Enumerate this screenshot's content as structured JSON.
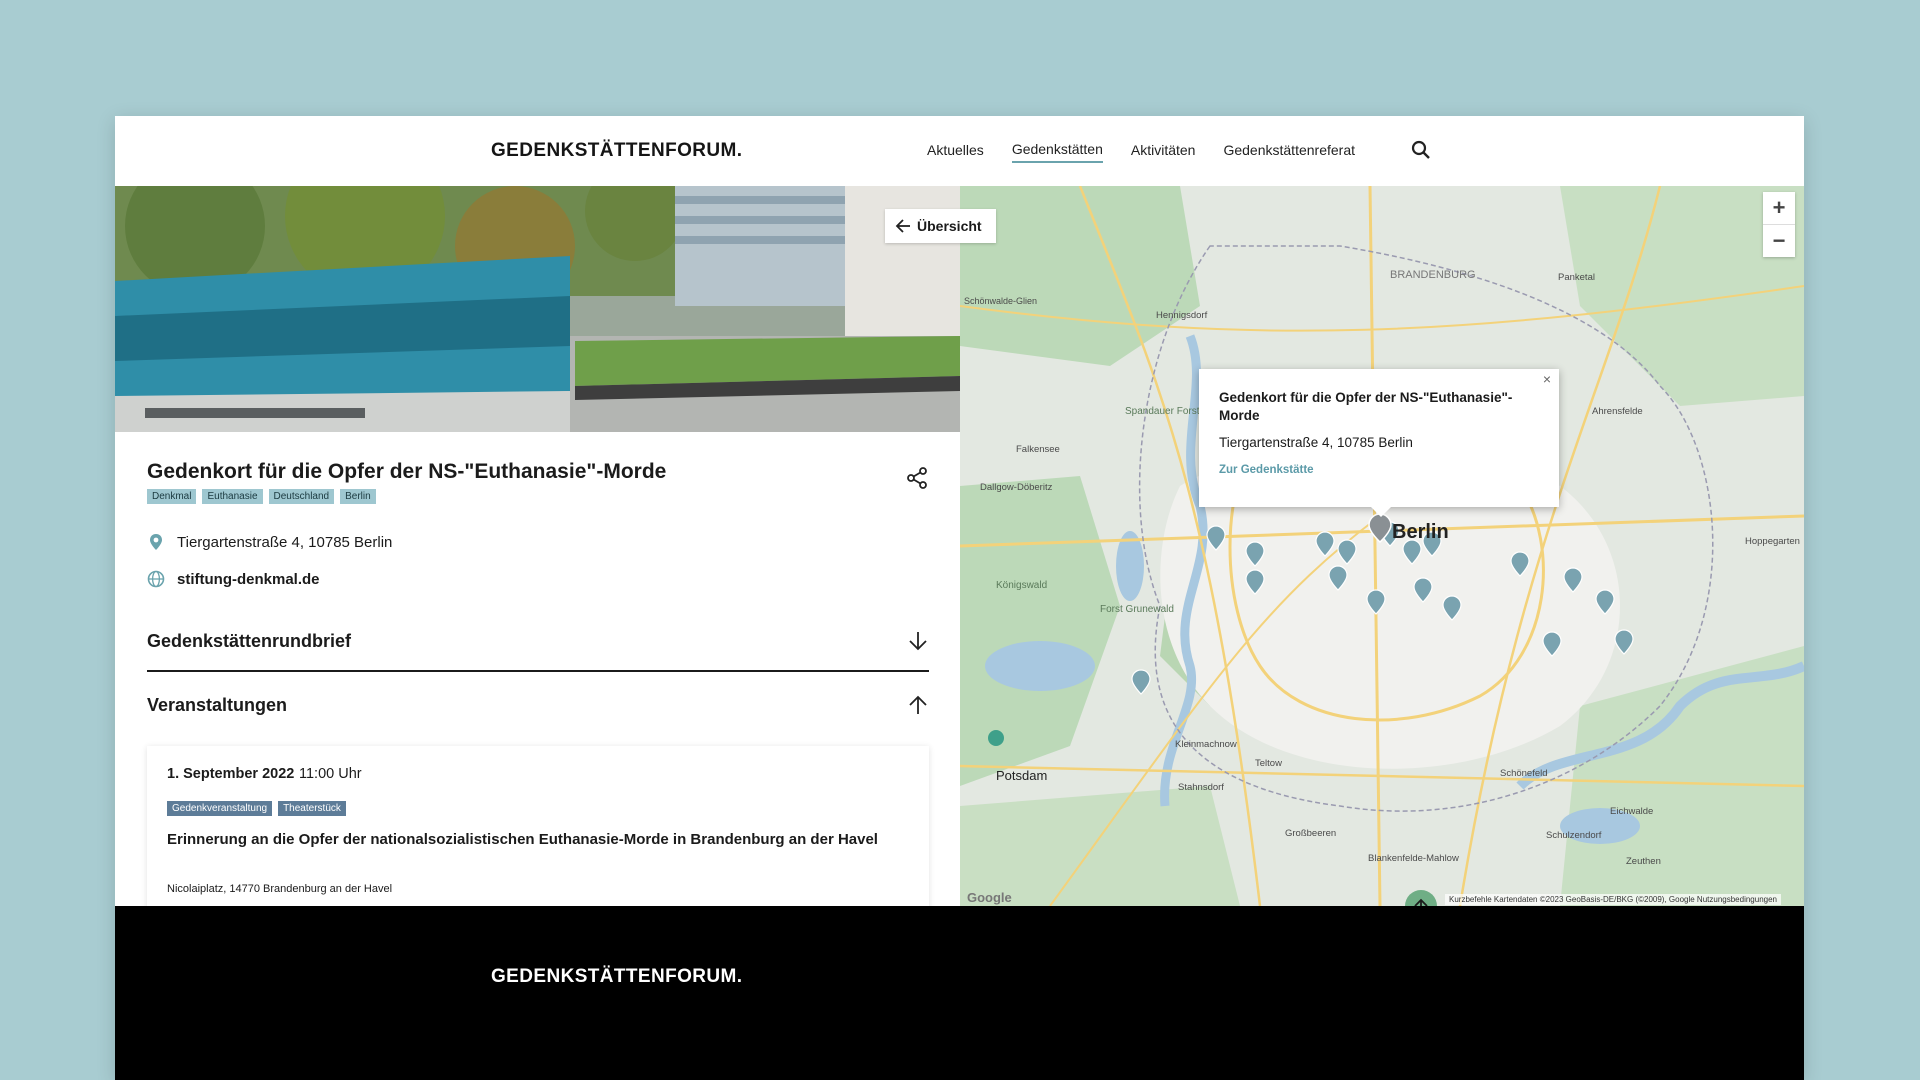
{
  "header": {
    "logo": "GEDENKSTÄTTENFORUM.",
    "nav": [
      {
        "label": "Aktuelles"
      },
      {
        "label": "Gedenkstätten"
      },
      {
        "label": "Aktivitäten"
      },
      {
        "label": "Gedenkstättenreferat"
      }
    ]
  },
  "site": {
    "title": "Gedenkort für die Opfer der NS-\"Euthanasie\"-Morde",
    "tags": [
      "Denkmal",
      "Euthanasie",
      "Deutschland",
      "Berlin"
    ],
    "address": "Tiergartenstraße 4, 10785 Berlin",
    "website": "stiftung-denkmal.de"
  },
  "accordion": {
    "newsletter": "Gedenkstättenrundbrief",
    "events": "Veranstaltungen"
  },
  "event": {
    "date": "1. September 2022",
    "time": "11:00 Uhr",
    "tags": [
      "Gedenkveranstaltung",
      "Theaterstück"
    ],
    "title": "Erinnerung an die Opfer der nationalsozialistischen Euthanasie-Morde in Brandenburg an der Havel",
    "location": "Nicolaiplatz, 14770 Brandenburg an der Havel"
  },
  "map": {
    "overview_label": "Übersicht",
    "popup_title": "Gedenkort für die Opfer der NS-\"Euthanasie\"-Morde",
    "popup_address": "Tiergartenstraße 4, 10785 Berlin",
    "popup_link": "Zur Gedenkstätte",
    "labels": [
      "Berlin",
      "Potsdam",
      "Falkensee",
      "Teltow",
      "Stahnsdorf",
      "Kleinmachnow",
      "Schulzendorf",
      "Zeuthen",
      "Hoppegarten",
      "Spandauer Forst",
      "Forst Grunewald",
      "Königswald",
      "Schönwalde-Glien",
      "Hennigsdorf",
      "Dallgow-Döberitz",
      "Panketal",
      "Ahrensfelde",
      "Eichwalde",
      "Schönefeld",
      "Großbeeren",
      "Blankenfelde-Mahlow",
      "BRANDENBURG"
    ],
    "attribution": "Kurzbefehle   Kartendaten ©2023 GeoBasis-DE/BKG (©2009), Google   Nutzungsbedingungen",
    "google": "Google",
    "zoom_in": "+",
    "zoom_out": "−",
    "close": "×"
  },
  "footer": {
    "logo": "GEDENKSTÄTTENFORUM."
  }
}
